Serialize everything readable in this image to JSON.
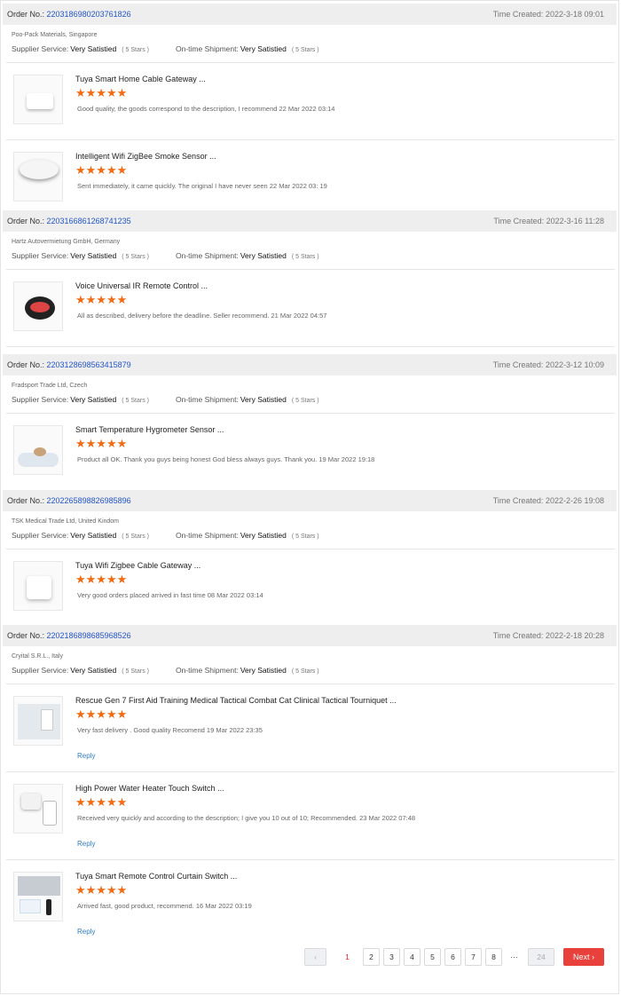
{
  "labels": {
    "order_no": "Order No.:",
    "supplier_service": "Supplier Service:",
    "ontime_shipment": "On-time Shipment:",
    "reply": "Reply",
    "stars": "★★★★★"
  },
  "orders": [
    {
      "order_no": "2203186980203761826",
      "time_created": "Time Created: 2022-3-18 09:01",
      "supplier": "Poo-Pack Materials, Singapore",
      "supplier_rating": "Very Satistied",
      "supplier_stars": "( 5 Stars )",
      "shipment_rating": "Very Satistied",
      "shipment_stars": "( 5 Stars )",
      "items": [
        {
          "title": "Tuya Smart Home Cable Gateway ...",
          "comment": "Good quality, the goods correspond to the description, I recommend  22 Mar 2022 03:14"
        },
        {
          "title": "Intelligent Wifi ZigBee Smoke Sensor ...",
          "comment": "Sent immediately, it came quickly. The original I have never seen  22 Mar 2022 03: 19"
        }
      ]
    },
    {
      "order_no": "2203166861268741235",
      "time_created": "Time Created: 2022-3-16 11:28",
      "supplier": "Hartz Autovermietung GmbH, Germany",
      "supplier_rating": "Very Satistied",
      "supplier_stars": "( 5 Stars )",
      "shipment_rating": "Very Satistied",
      "shipment_stars": "( 5 Stars )",
      "items": [
        {
          "title": "Voice Universal IR Remote Control ...",
          "comment": "All as described, delivery before the deadline. Seller recommend. 21 Mar 2022  04:57"
        }
      ]
    },
    {
      "order_no": "2203128698563415879",
      "time_created": "Time Created: 2022-3-12 10:09",
      "supplier": "Fradsport Trade Ltd, Czech",
      "supplier_rating": "Very Satistied",
      "supplier_stars": "( 5 Stars )",
      "shipment_rating": "Very Satistied",
      "shipment_stars": "( 5 Stars )",
      "items": [
        {
          "title": "Smart Temperature Hygrometer Sensor ...",
          "comment": "Product all OK. Thank you guys being honest God bless always guys. Thank you.  19 Mar 2022 19:18"
        }
      ]
    },
    {
      "order_no": "2202265898826985896",
      "time_created": "Time Created: 2022-2-26 19:08",
      "supplier": "TSK Medical Trade Ltd, United Kindom",
      "supplier_rating": "Very Satistied",
      "supplier_stars": "( 5 Stars )",
      "shipment_rating": "Very Satistied",
      "shipment_stars": "( 5 Stars )",
      "items": [
        {
          "title": "Tuya Wifi Zigbee Cable Gateway ...",
          "comment": "Very good orders placed arrived in fast time  08 Mar 2022 03:14"
        }
      ]
    },
    {
      "order_no": "2202186898685968526",
      "time_created": "Time Created: 2022-2-18 20:28",
      "supplier": "Cryital S.R.L., Italy",
      "supplier_rating": "Very Satistied",
      "supplier_stars": "( 5 Stars )",
      "shipment_rating": "Very Satistied",
      "shipment_stars": "( 5 Stars )",
      "items": [
        {
          "title": "Rescue Gen 7 First Aid Training Medical Tactical Combat Cat Clinical Tactical Tourniquet ...",
          "comment": "Very fast delivery . Good quality Recomend 19 Mar 2022 23:35"
        },
        {
          "title": "High Power Water Heater Touch Switch ...",
          "comment": "Received very quickly and according to the description; I give you 10 out of 10; Recommended. 23 Mar 2022 07:48"
        },
        {
          "title": "Tuya Smart Remote Control Curtain Switch ...",
          "comment": "Arrived fast, good product, recommend. 16 Mar 2022 03:19"
        }
      ]
    }
  ],
  "pagination": {
    "prev": "‹",
    "pages": [
      "1",
      "2",
      "3",
      "4",
      "5",
      "6",
      "7",
      "8"
    ],
    "current": "1",
    "ellipsis": "···",
    "last": "24",
    "next": "Next ›"
  }
}
